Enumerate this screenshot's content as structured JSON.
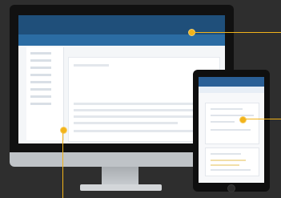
{
  "desktop_app": {
    "brand": "",
    "nav": [
      "",
      "",
      "",
      ""
    ],
    "subtitle": "",
    "tabs": [
      "",
      "",
      "",
      "",
      ""
    ]
  },
  "tablet_app": {
    "title": ""
  },
  "colors": {
    "background": "#2e2e2e",
    "accent_callout": "#f2b31a",
    "app_header": "#1f4f7a",
    "app_subheader": "#2b6ca3"
  },
  "icons": [
    "callout-dot-icon"
  ]
}
